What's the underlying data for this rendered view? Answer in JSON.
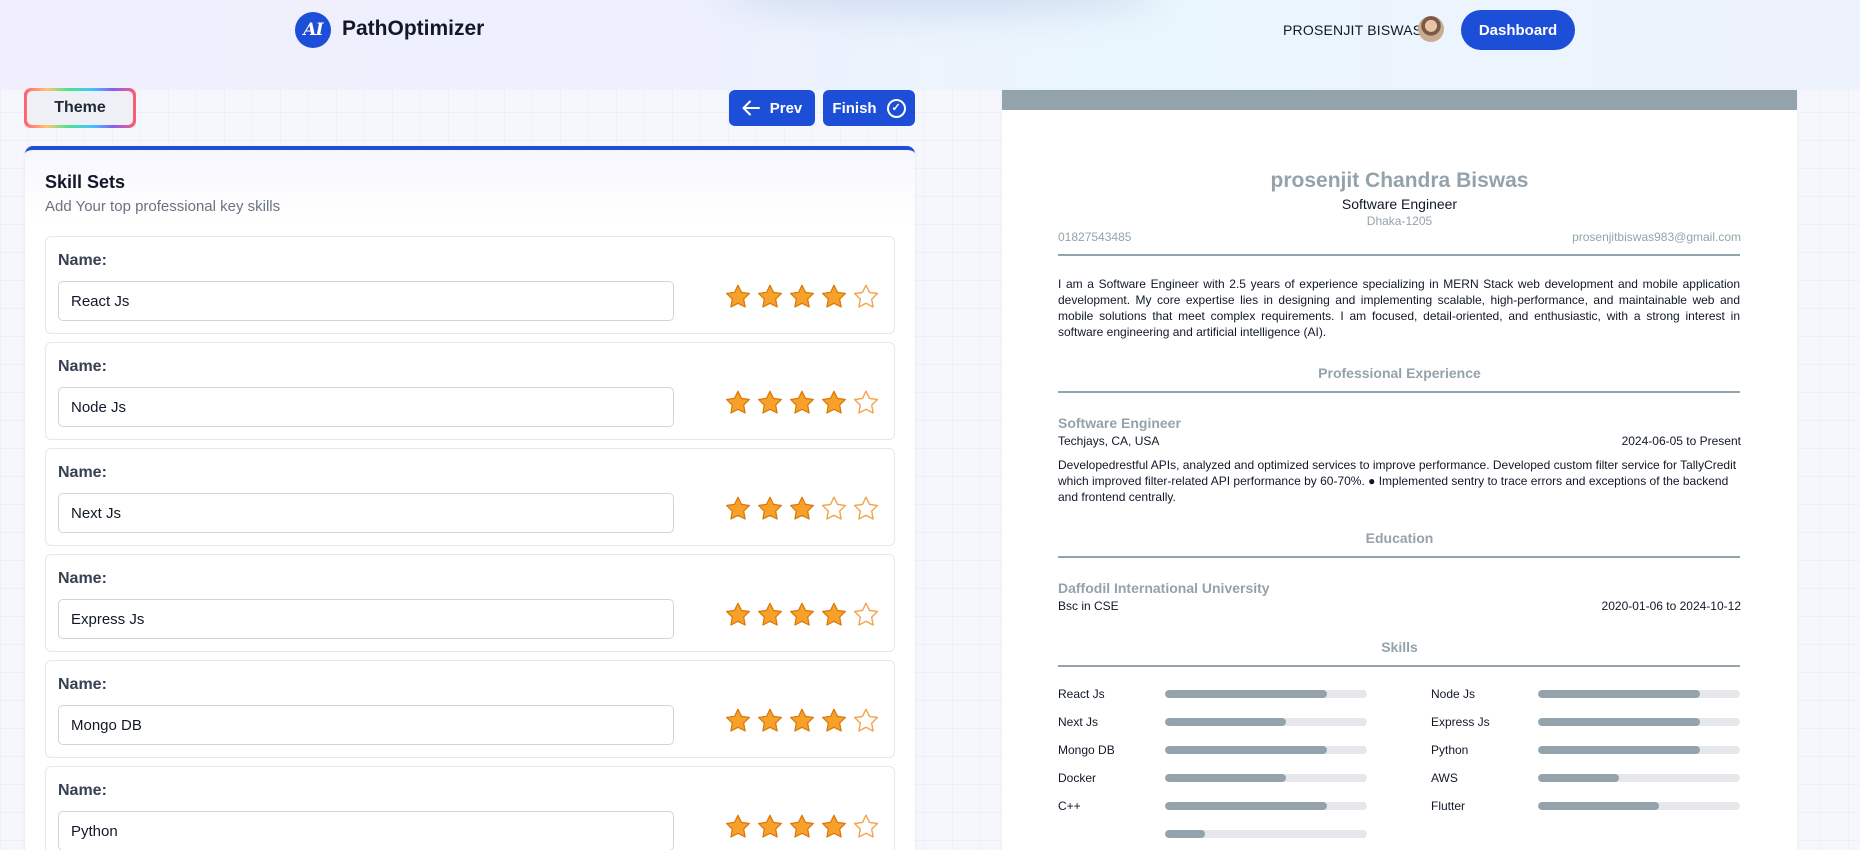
{
  "header": {
    "logo_text": "AI",
    "brand": "PathOptimizer",
    "username": "PROSENJIT BISWAS",
    "dashboard_label": "Dashboard"
  },
  "toolbar": {
    "theme_label": "Theme",
    "prev_label": "Prev",
    "finish_label": "Finish"
  },
  "skills_panel": {
    "title": "Skill Sets",
    "subtitle": "Add Your top professional key skills",
    "name_label": "Name:",
    "star_colors": {
      "filled": "#f59e0b",
      "empty": "#f59e0b"
    },
    "items": [
      {
        "name": "React Js",
        "rating": 4,
        "max": 5
      },
      {
        "name": "Node Js",
        "rating": 4,
        "max": 5
      },
      {
        "name": "Next Js",
        "rating": 3,
        "max": 5
      },
      {
        "name": "Express Js",
        "rating": 4,
        "max": 5
      },
      {
        "name": "Mongo DB",
        "rating": 4,
        "max": 5
      },
      {
        "name": "Python",
        "rating": 4,
        "max": 5
      }
    ]
  },
  "resume": {
    "accent_color": "#94a3ab",
    "name": "prosenjit Chandra Biswas",
    "job_title": "Software Engineer",
    "address": "Dhaka-1205",
    "phone": "01827543485",
    "email": "prosenjitbiswas983@gmail.com",
    "summary": "I am a Software Engineer with 2.5 years of experience specializing in MERN Stack web development and mobile application development. My core expertise lies in designing and implementing scalable, high-performance, and maintainable web and mobile solutions that meet complex requirements. I am focused, detail-oriented, and enthusiastic, with a strong interest in software engineering and artificial intelligence (AI).",
    "experience_heading": "Professional Experience",
    "experience": {
      "title": "Software Engineer",
      "company": "Techjays, CA, USA",
      "dates": "2024-06-05 to Present",
      "description": "Developedrestful APIs, analyzed and optimized services to improve performance. Developed custom filter service for TallyCredit which improved filter-related API performance by 60-70%. ● Implemented sentry to trace errors and exceptions of the backend and frontend centrally."
    },
    "education_heading": "Education",
    "education": {
      "school": "Daffodil International University",
      "degree": "Bsc in CSE",
      "dates": "2020-01-06 to 2024-10-12"
    },
    "skills_heading": "Skills",
    "skills": [
      {
        "name": "React Js",
        "level": 0.8
      },
      {
        "name": "Node Js",
        "level": 0.8
      },
      {
        "name": "Next Js",
        "level": 0.6
      },
      {
        "name": "Express Js",
        "level": 0.8
      },
      {
        "name": "Mongo DB",
        "level": 0.8
      },
      {
        "name": "Python",
        "level": 0.8
      },
      {
        "name": "Docker",
        "level": 0.6
      },
      {
        "name": "AWS",
        "level": 0.4
      },
      {
        "name": "C++",
        "level": 0.8
      },
      {
        "name": "Flutter",
        "level": 0.6
      },
      {
        "name": "",
        "level": 0.2
      }
    ]
  }
}
